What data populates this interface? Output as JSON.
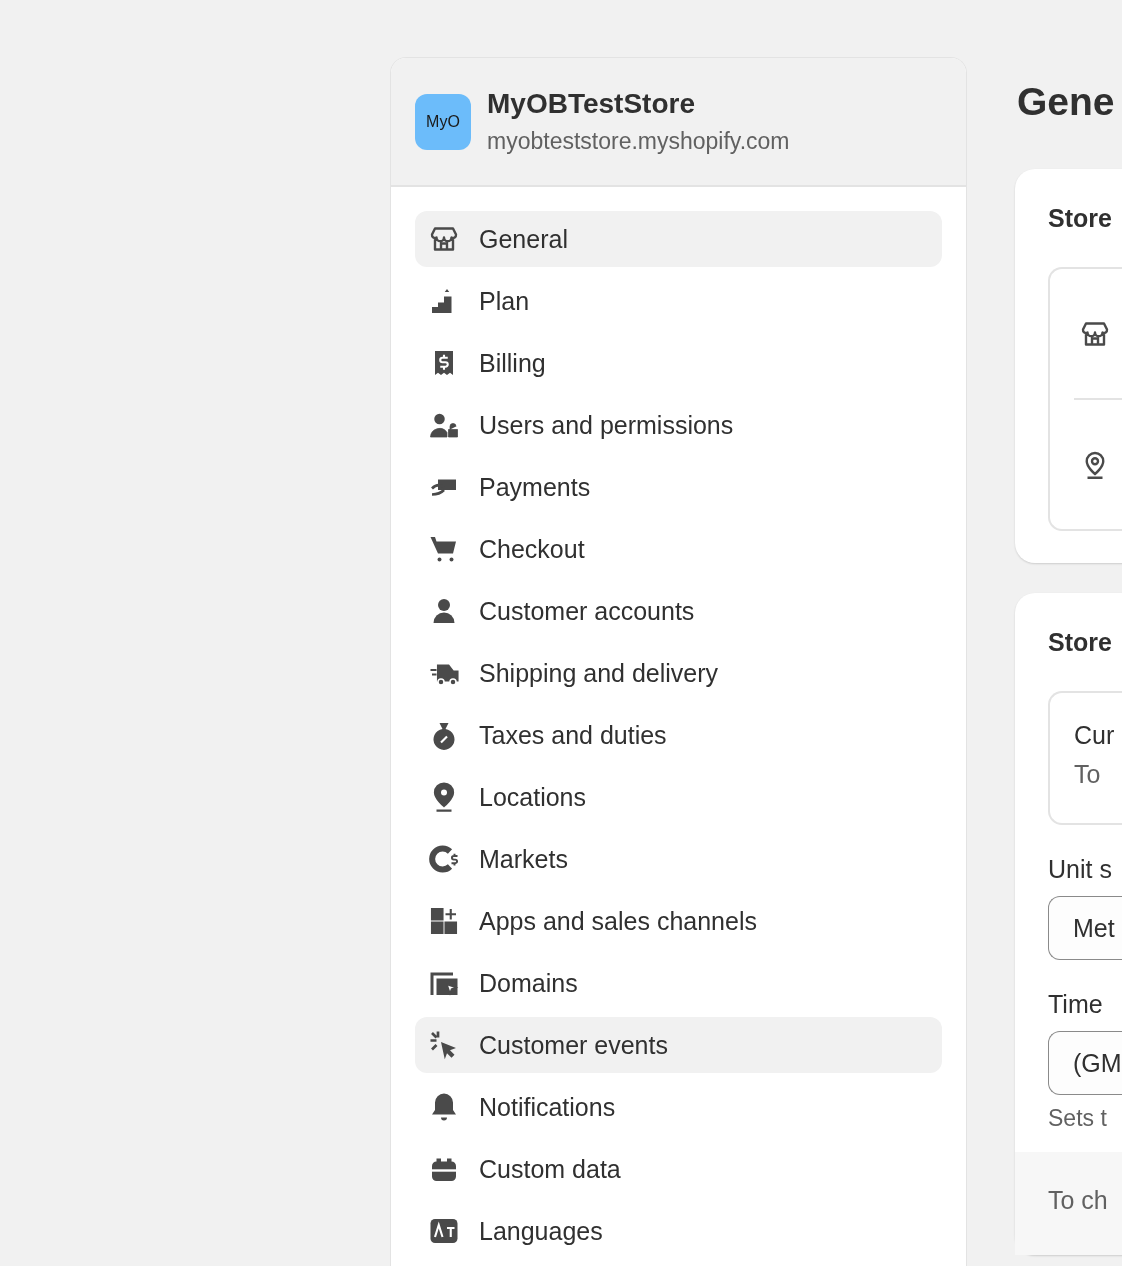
{
  "store": {
    "avatar": "MyO",
    "name": "MyOBTestStore",
    "domain": "myobteststore.myshopify.com"
  },
  "nav": [
    {
      "label": "General",
      "selected": true
    },
    {
      "label": "Plan",
      "selected": false
    },
    {
      "label": "Billing",
      "selected": false
    },
    {
      "label": "Users and permissions",
      "selected": false
    },
    {
      "label": "Payments",
      "selected": false
    },
    {
      "label": "Checkout",
      "selected": false
    },
    {
      "label": "Customer accounts",
      "selected": false
    },
    {
      "label": "Shipping and delivery",
      "selected": false
    },
    {
      "label": "Taxes and duties",
      "selected": false
    },
    {
      "label": "Locations",
      "selected": false
    },
    {
      "label": "Markets",
      "selected": false
    },
    {
      "label": "Apps and sales channels",
      "selected": false
    },
    {
      "label": "Domains",
      "selected": false
    },
    {
      "label": "Customer events",
      "selected": true
    },
    {
      "label": "Notifications",
      "selected": false
    },
    {
      "label": "Custom data",
      "selected": false
    },
    {
      "label": "Languages",
      "selected": false
    }
  ],
  "main": {
    "title": "Gene",
    "details_card": {
      "heading": "Store"
    },
    "defaults_card": {
      "heading": "Store",
      "currency_title": "Cur",
      "currency_text": "To",
      "unit_label": "Unit s",
      "unit_value": "Met",
      "timezone_label": "Time",
      "timezone_value": "(GM",
      "timezone_help": "Sets t",
      "footer": "To ch"
    }
  }
}
